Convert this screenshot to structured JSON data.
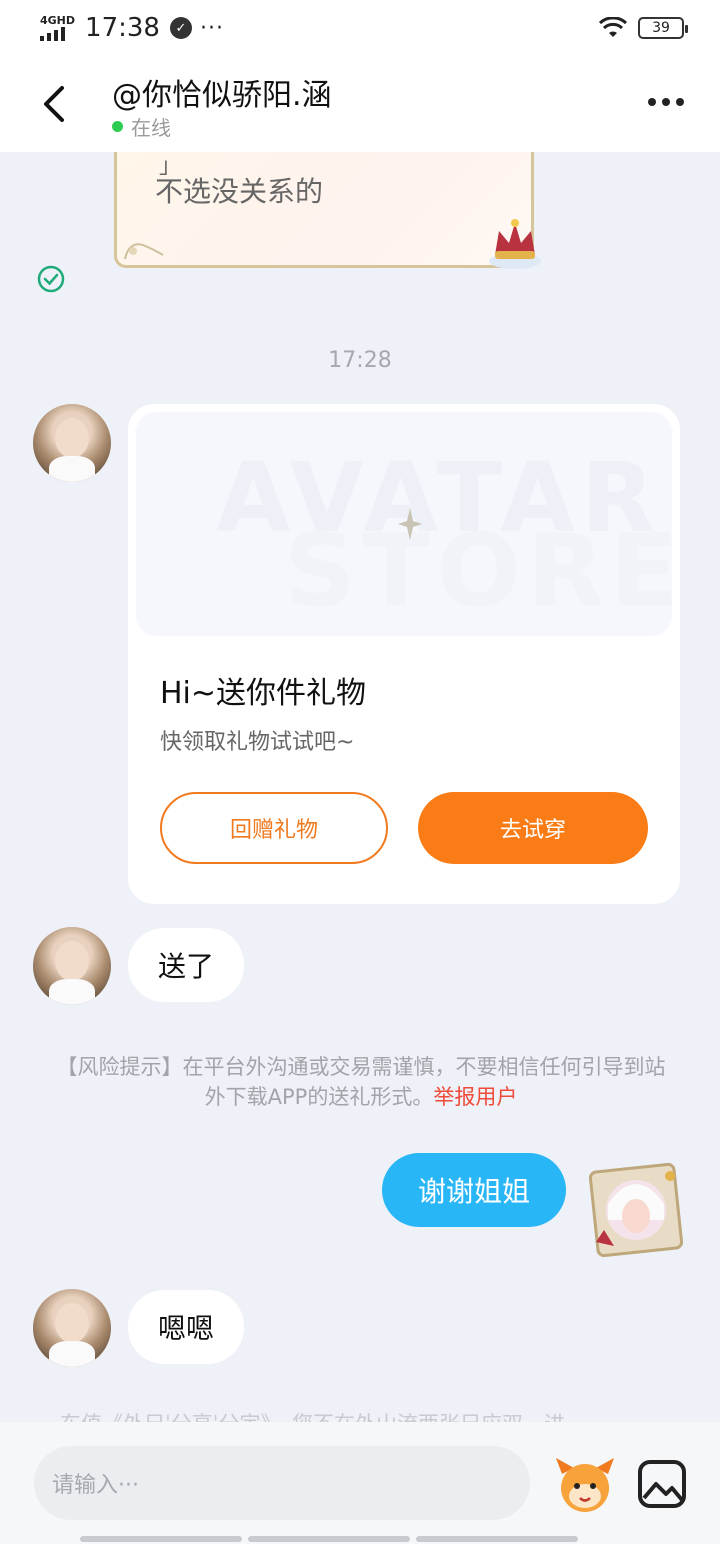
{
  "status_bar": {
    "network": "4GHD",
    "time": "17:38",
    "more": "···",
    "battery": "39",
    "icons": [
      "signal-icon",
      "wifi-icon",
      "battery-icon"
    ]
  },
  "header": {
    "title": "@你恰似骄阳.涵",
    "status": "在线",
    "icons": [
      "back-icon",
      "more-icon"
    ],
    "status_color": "#2ecc52"
  },
  "messages": {
    "prev_card": {
      "text": "不选没关系的",
      "bracket": "」"
    },
    "timestamp": "17:28",
    "gift_card": {
      "banner_word_1": "AVATAR",
      "banner_word_2": "STORE",
      "title": "Hi~送你件礼物",
      "subtitle": "快领取礼物试试吧~",
      "return_gift_label": "回赠礼物",
      "try_on_label": "去试穿"
    },
    "msg_sent_gift": "送了",
    "risk_notice": "【风险提示】在平台外沟通或交易需谨慎，不要相信任何引导到站外下载APP的送礼形式。",
    "report_label": "举报用户",
    "msg_thanks": "谢谢姐姐",
    "msg_en": "嗯嗯",
    "faded_notice": "东值《外兄ˈ分亨ˈ分宇》，您不在外山流西张兄应双，进"
  },
  "input_bar": {
    "placeholder": "请输入···",
    "icons": [
      "emoji-icon",
      "image-icon"
    ]
  },
  "colors": {
    "accent_orange": "#fa7c16",
    "bubble_blue": "#29b6f6",
    "report_red": "#ef4a3a",
    "background": "#eef1f7"
  }
}
